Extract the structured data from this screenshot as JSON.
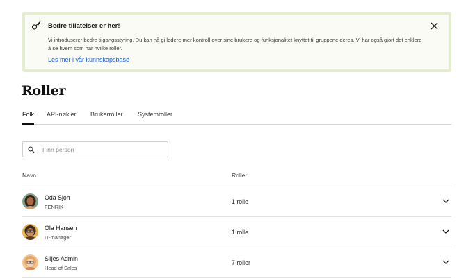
{
  "banner": {
    "title": "Bedre tillatelser er her!",
    "text": "Vi introduserer bedre tilgangsstyring. Du kan nå gi ledere mer kontroll over sine brukere og funksjonalitet knyttet til gruppene deres. Vi har også gjort det enklere å se hvem som har hvilke roller.",
    "link": "Les mer i vår kunnskapsbase",
    "icon": "key-icon",
    "close_icon": "close-icon",
    "border_color": "#e4ecd2",
    "link_color": "#1f5fc4"
  },
  "page": {
    "title": "Roller"
  },
  "tabs": [
    {
      "label": "Folk",
      "active": true
    },
    {
      "label": "API-nøkler",
      "active": false
    },
    {
      "label": "Brukerroller",
      "active": false
    },
    {
      "label": "Systemroller",
      "active": false
    }
  ],
  "search": {
    "placeholder": "Finn person",
    "value": "",
    "icon": "search-icon"
  },
  "table": {
    "columns": [
      "Navn",
      "Roller"
    ],
    "rows": [
      {
        "name": "Oda Sjoh",
        "title": "FENRIK",
        "roles": "1 rolle"
      },
      {
        "name": "Ola Hansen",
        "title": "IT-manager",
        "roles": "1 rolle"
      },
      {
        "name": "Siljes Admin",
        "title": "Head of Sales",
        "roles": "7 roller"
      }
    ]
  }
}
